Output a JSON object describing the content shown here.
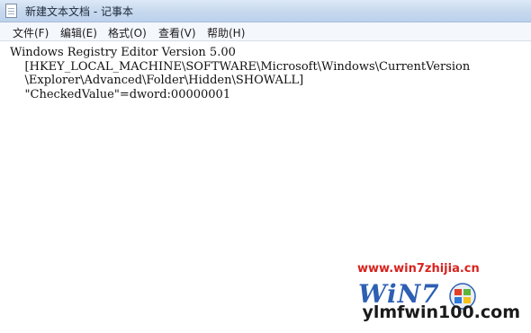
{
  "window": {
    "title": "新建文本文档 - 记事本"
  },
  "menu": [
    {
      "label": "文件(F)"
    },
    {
      "label": "编辑(E)"
    },
    {
      "label": "格式(O)"
    },
    {
      "label": "查看(V)"
    },
    {
      "label": "帮助(H)"
    }
  ],
  "editor": {
    "content": "Windows Registry Editor Version 5.00\n    [HKEY_LOCAL_MACHINE\\SOFTWARE\\Microsoft\\Windows\\CurrentVersion\n    \\Explorer\\Advanced\\Folder\\Hidden\\SHOWALL]\n    \"CheckedValue\"=dword:00000001"
  },
  "watermark": {
    "url": "www.win7zhijia.cn",
    "logo_text": "WiN7",
    "brand": "ylmfwin100.com",
    "url_color": "#d8231f",
    "logo_color": "#2d5fb3"
  }
}
